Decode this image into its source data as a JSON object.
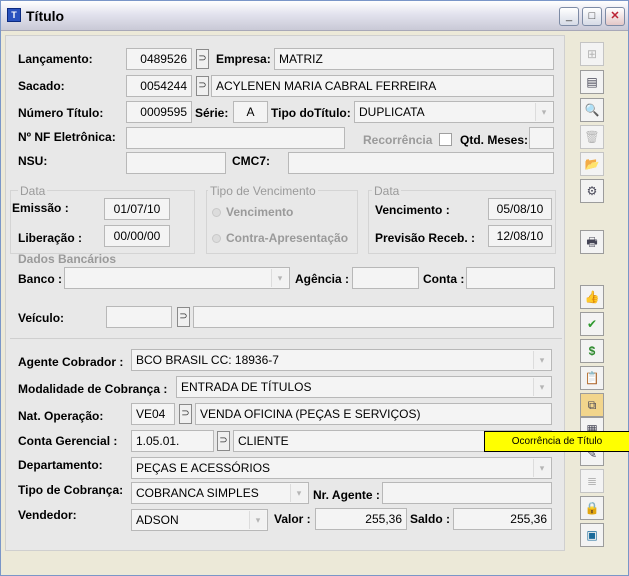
{
  "window": {
    "title": "Título",
    "min_glyph": "_",
    "max_glyph": "□",
    "close_glyph": "✕"
  },
  "labels": {
    "lancamento": "Lançamento:",
    "empresa": "Empresa:",
    "sacado": "Sacado:",
    "numero_titulo": "Número Título:",
    "serie": "Série:",
    "tipo_titulo": "Tipo doTítulo:",
    "nf_eletronica": "Nº NF Eletrônica:",
    "recorrencia": "Recorrência",
    "qtd_meses": "Qtd. Meses:",
    "nsu": "NSU:",
    "cmc7": "CMC7:",
    "data_group": "Data",
    "emissao": "Emissão :",
    "liberacao": "Liberação :",
    "tipo_venc_group": "Tipo de Vencimento",
    "vencimento_radio": "Vencimento",
    "contra_radio": "Contra-Apresentação",
    "data_group2": "Data",
    "vencimento": "Vencimento :",
    "previsao": "Previsão Receb. :",
    "dados_bancarios": "Dados Bancários",
    "banco": "Banco :",
    "agencia": "Agência :",
    "conta": "Conta :",
    "veiculo": "Veículo:",
    "agente_cobrador": "Agente Cobrador :",
    "modalidade": "Modalidade de Cobrança :",
    "nat_operacao": "Nat. Operação:",
    "conta_gerencial": "Conta Gerencial :",
    "departamento": "Departamento:",
    "tipo_cobranca": "Tipo de Cobrança:",
    "nr_agente": "Nr. Agente :",
    "vendedor": "Vendedor:",
    "valor": "Valor :",
    "saldo": "Saldo :"
  },
  "values": {
    "lancamento": "0489526",
    "empresa": "MATRIZ",
    "sacado_code": "0054244",
    "sacado_name": "ACYLENEN MARIA CABRAL FERREIRA",
    "numero_titulo": "0009595",
    "serie": "A",
    "tipo_titulo": "DUPLICATA",
    "nf_eletronica": "",
    "qtd_meses": "",
    "nsu": "",
    "cmc7": "",
    "emissao": "01/07/10",
    "liberacao": "00/00/00",
    "vencimento": "05/08/10",
    "previsao": "12/08/10",
    "banco": "",
    "agencia": "",
    "conta": "",
    "veiculo_code": "",
    "veiculo_desc": "",
    "agente_cobrador": "BCO BRASIL CC: 18936-7",
    "modalidade": "ENTRADA DE TÍTULOS",
    "nat_operacao_code": "VE04",
    "nat_operacao_desc": "VENDA OFICINA (PEÇAS E SERVIÇOS)",
    "conta_gerencial_code": "1.05.01.",
    "conta_gerencial_desc": "CLIENTE",
    "departamento": "PEÇAS E ACESSÓRIOS",
    "tipo_cobranca": "COBRANCA SIMPLES",
    "nr_agente": "",
    "vendedor": "ADSON",
    "valor": "255,36",
    "saldo": "255,36"
  },
  "tooltip": "Ocorrência de Título",
  "icons": {
    "lookup": "⊃",
    "dropdown": "▾",
    "toolbar": [
      "insert-record-icon",
      "table-icon",
      "preview-icon",
      "delete-icon",
      "folder-icon",
      "settings-icon",
      "print-icon",
      "thumbs-up-icon",
      "check-icon",
      "money-bag-icon",
      "clipboard-icon",
      "copy-icon",
      "ocorrencia-icon",
      "edit-icon",
      "list-icon",
      "lock-doc-icon",
      "calculator-icon"
    ],
    "toolbar_glyphs": [
      "⊞",
      "▤",
      "🔍",
      "🗑",
      "📂",
      "⚙",
      "🖶",
      "👍",
      "✔",
      "$",
      "📋",
      "⧉",
      "▦",
      "✎",
      "≣",
      "🔒",
      "▣"
    ]
  }
}
